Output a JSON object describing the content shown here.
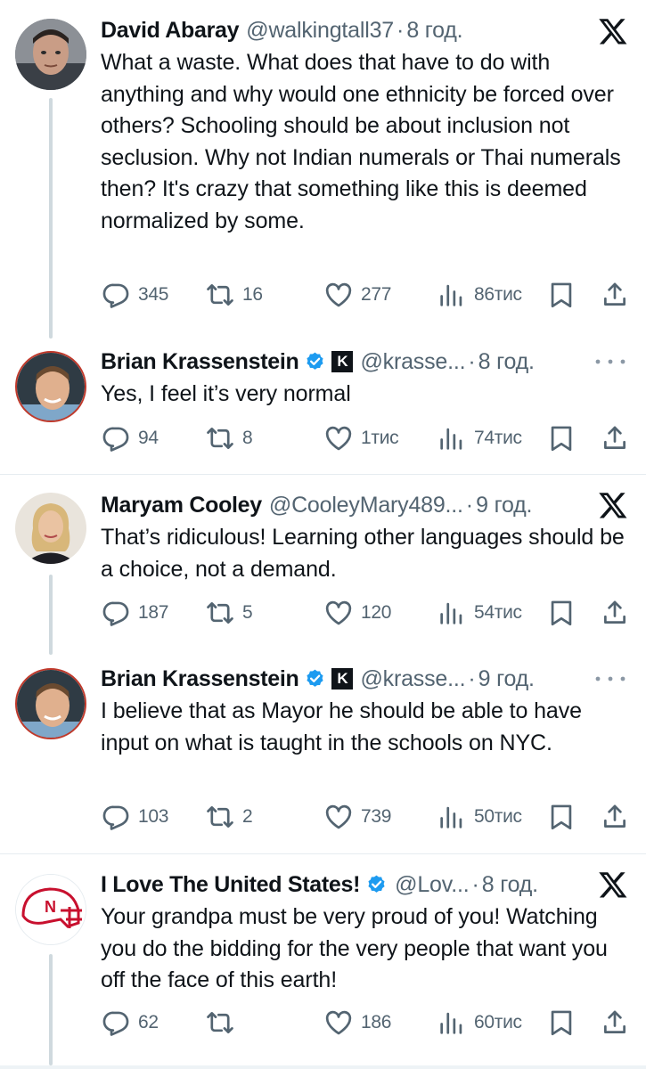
{
  "tweets": [
    {
      "name": "David Abaray",
      "handle": "@walkingtall37",
      "time": "8 год.",
      "text": "What a waste.  What does that have to do with anything and why would one ethnicity be forced over others?  Schooling should be about inclusion not seclusion.  Why not Indian numerals or Thai numerals then?  It's crazy that something like this is deemed normalized by some.",
      "replies": "345",
      "reposts": "16",
      "likes": "277",
      "views": "86тис"
    },
    {
      "name": "Brian Krassenstein",
      "handle": "@krasse...",
      "time": "8 год.",
      "text": "Yes, I feel it’s very normal",
      "replies": "94",
      "reposts": "8",
      "likes": "1тис",
      "views": "74тис"
    },
    {
      "name": "Maryam Cooley",
      "handle": "@CooleyMary489...",
      "time": "9 год.",
      "text": "That’s ridiculous! Learning other languages should be a choice, not a demand.",
      "replies": "187",
      "reposts": "5",
      "likes": "120",
      "views": "54тис"
    },
    {
      "name": "Brian Krassenstein",
      "handle": "@krasse...",
      "time": "9 год.",
      "text": "I believe that as Mayor he should be able to have input on what is taught in the schools on NYC.",
      "replies": "103",
      "reposts": "2",
      "likes": "739",
      "views": "50тис"
    },
    {
      "name": "I Love The United States!",
      "handle": "@Lov...",
      "time": "8 год.",
      "text": "Your grandpa must be very proud of you! Watching you do the bidding for the very people that want you off the face of this earth!",
      "replies": "62",
      "reposts": "",
      "likes": "186",
      "views": "60тис"
    }
  ],
  "separator": "·",
  "badge_letter": "K",
  "avatar_letter": "N",
  "icons": [
    "x-logo-icon",
    "more-icon",
    "verified-badge-icon",
    "reply-icon",
    "repost-icon",
    "like-icon",
    "views-icon",
    "bookmark-icon",
    "share-icon"
  ],
  "colors": {
    "text": "#0f1419",
    "muted": "#536471",
    "verified": "#1d9bf0",
    "divider": "#e6ecf0"
  }
}
